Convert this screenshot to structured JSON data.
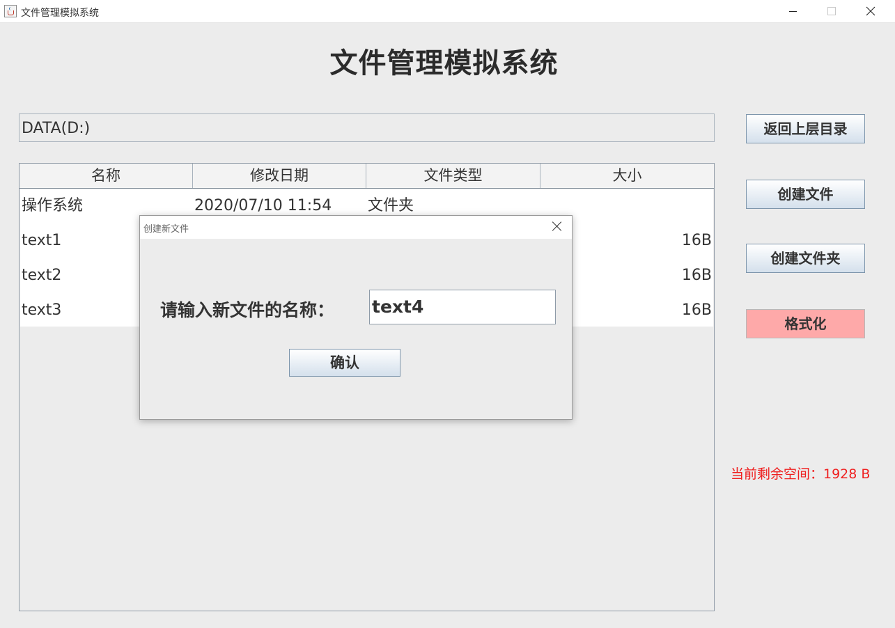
{
  "window": {
    "title": "文件管理模拟系统",
    "icon": "java-cup-icon",
    "controls": [
      "minimize-icon",
      "maximize-icon",
      "close-icon"
    ]
  },
  "header": {
    "title": "文件管理模拟系统"
  },
  "path": {
    "value": "DATA(D:)"
  },
  "table": {
    "columns": [
      "名称",
      "修改日期",
      "文件类型",
      "大小"
    ],
    "rows": [
      {
        "name": "操作系统",
        "date": "2020/07/10 11:54",
        "type": "文件夹",
        "size": ""
      },
      {
        "name": "text1",
        "date": "",
        "type": "",
        "size": "16B"
      },
      {
        "name": "text2",
        "date": "",
        "type": "",
        "size": "16B"
      },
      {
        "name": "text3",
        "date": "",
        "type": "",
        "size": "16B"
      }
    ]
  },
  "sidebar": {
    "back_label": "返回上层目录",
    "create_file_label": "创建文件",
    "create_folder_label": "创建文件夹",
    "format_label": "格式化",
    "format_color": "#fea9a9",
    "space_label": "当前剩余空间：1928 B",
    "space_color": "#ef2020"
  },
  "dialog": {
    "title": "创建新文件",
    "prompt": "请输入新文件的名称：",
    "input_value": "text4",
    "confirm_label": "确认"
  }
}
